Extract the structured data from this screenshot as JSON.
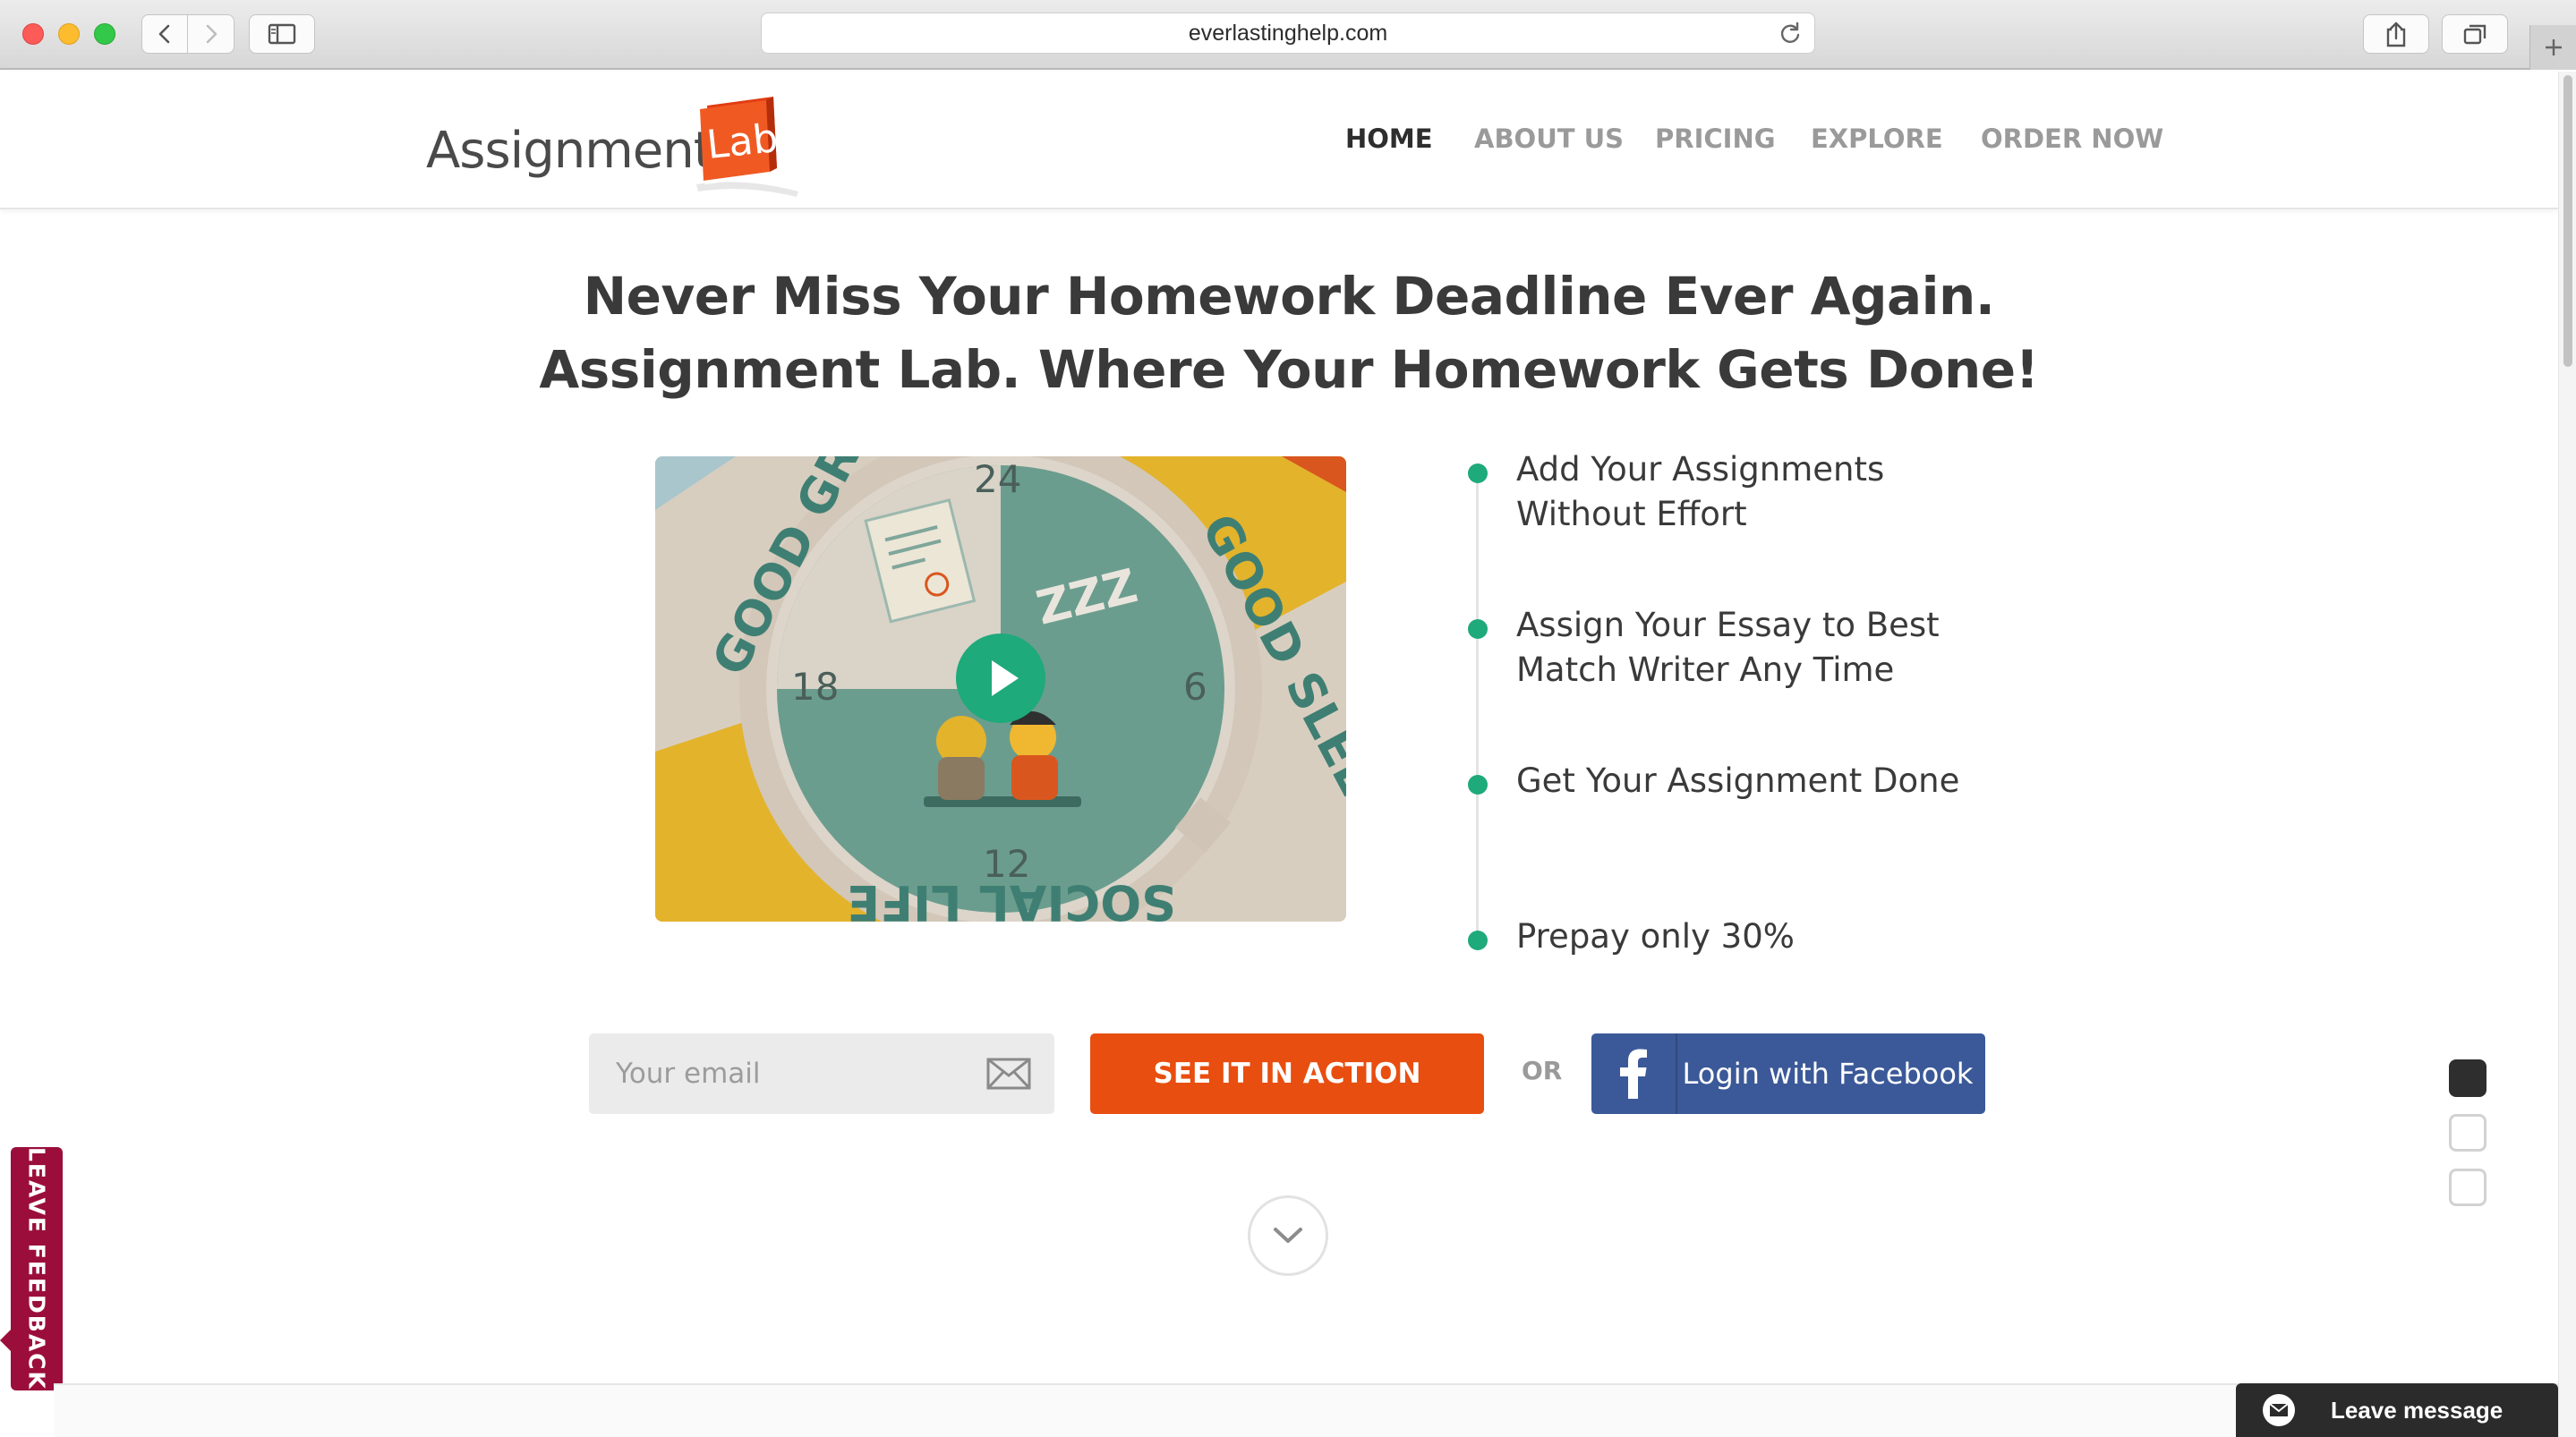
{
  "browser": {
    "url": "everlastinghelp.com"
  },
  "site": {
    "logo_text": "Assignment",
    "logo_badge": "Lab",
    "nav": [
      {
        "label": "HOME",
        "active": true
      },
      {
        "label": "ABOUT US",
        "active": false
      },
      {
        "label": "PRICING",
        "active": false
      },
      {
        "label": "EXPLORE",
        "active": false
      },
      {
        "label": "ORDER NOW",
        "active": false
      }
    ]
  },
  "hero": {
    "headline_line1": "Never Miss Your Homework Deadline Ever Again.",
    "headline_line2": "Assignment Lab. Where Your Homework Gets Done!",
    "video": {
      "clock_numbers": [
        "24",
        "6",
        "12",
        "18"
      ],
      "arc_left": "GOOD GR",
      "arc_right": "GOOD SLEEP",
      "arc_bottom": "SOCIAL LIFE",
      "zzz": "ZZZ"
    },
    "steps": [
      {
        "text": "Add Your Assignments Without Effort"
      },
      {
        "text": "Assign Your Essay to Best Match Writer Any Time"
      },
      {
        "text": "Get Your Assignment Done"
      },
      {
        "text": "Prepay only 30%"
      }
    ]
  },
  "cta": {
    "email_placeholder": "Your email",
    "action_button": "SEE IT IN ACTION",
    "or_text": "OR",
    "facebook_button": "Login with Facebook"
  },
  "feedback_tab": "LEAVE FEEDBACK",
  "chat": {
    "label": "Leave message"
  },
  "pager": {
    "count": 3,
    "active_index": 0
  },
  "colors": {
    "accent_orange": "#e84e0f",
    "facebook_blue": "#3b5998",
    "step_green": "#1eaa7a",
    "feedback_red": "#9b0e3c",
    "video_teal": "#6b9d8e",
    "video_yellow": "#e3b32c"
  }
}
